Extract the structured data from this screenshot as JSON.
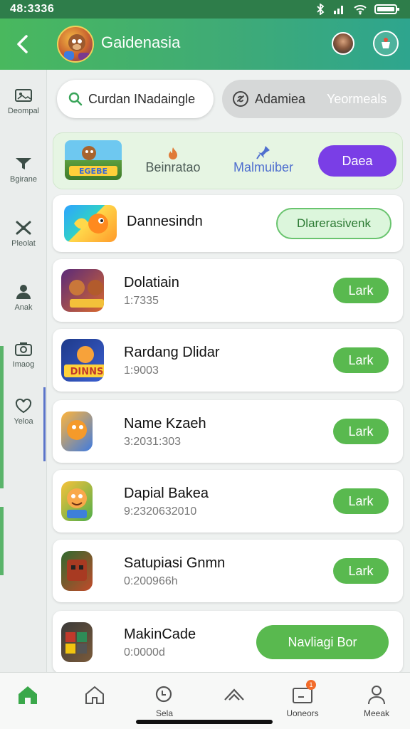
{
  "status_bar": {
    "time": "48:3336"
  },
  "app_bar": {
    "title": "Gaidenasia"
  },
  "left_rail": [
    {
      "label": "Deompal",
      "icon": "photo-frame-icon"
    },
    {
      "label": "Bgirane",
      "icon": "funnel-icon"
    },
    {
      "label": "Pleolat",
      "icon": "cross-tools-icon"
    },
    {
      "label": "Anak",
      "icon": "person-icon"
    },
    {
      "label": "Imaog",
      "icon": "camera-icon"
    },
    {
      "label": "Yeloa",
      "icon": "heart-icon"
    }
  ],
  "search": {
    "text": "Curdan INadaingle"
  },
  "tabs": {
    "active": "Adamiea",
    "inactive": "Yeormeals"
  },
  "categories": {
    "items": [
      {
        "label": "Beinratao",
        "color": "#e07b39"
      },
      {
        "label": "Malmuiber",
        "color": "#4f6fcf"
      }
    ],
    "button": "Daea",
    "thumb_text": "EGEBE"
  },
  "featured": {
    "name": "Dannesindn",
    "button": "Dlarerasivenk"
  },
  "apps": [
    {
      "name": "Dolatiain",
      "meta": "1:7335",
      "button": "Lark"
    },
    {
      "name": "Rardang Dlidar",
      "meta": "1:9003",
      "button": "Lark",
      "thumb_text": "DINNS"
    },
    {
      "name": "Name Kzaeh",
      "meta": "3:2031:303",
      "button": "Lark"
    },
    {
      "name": "Dapial Bakea",
      "meta": "9:2320632010",
      "button": "Lark"
    },
    {
      "name": "Satupiasi Gnmn",
      "meta": "0:200966h",
      "button": "Lark"
    },
    {
      "name": "MakinCade",
      "meta": "0:0000d",
      "button": "Navliagi Bor"
    }
  ],
  "bottom_nav": [
    {
      "label": "",
      "icon": "home-filled-icon"
    },
    {
      "label": "",
      "icon": "home-outline-icon"
    },
    {
      "label": "Sela",
      "icon": "search-icon"
    },
    {
      "label": "",
      "icon": "chevron-up-icon"
    },
    {
      "label": "Uoneors",
      "icon": "inbox-icon",
      "badge": "1"
    },
    {
      "label": "Meeak",
      "icon": "profile-icon"
    }
  ],
  "colors": {
    "primary": "#49b85e",
    "accent_purple": "#7a3ee6",
    "button_green": "#59b94f"
  }
}
